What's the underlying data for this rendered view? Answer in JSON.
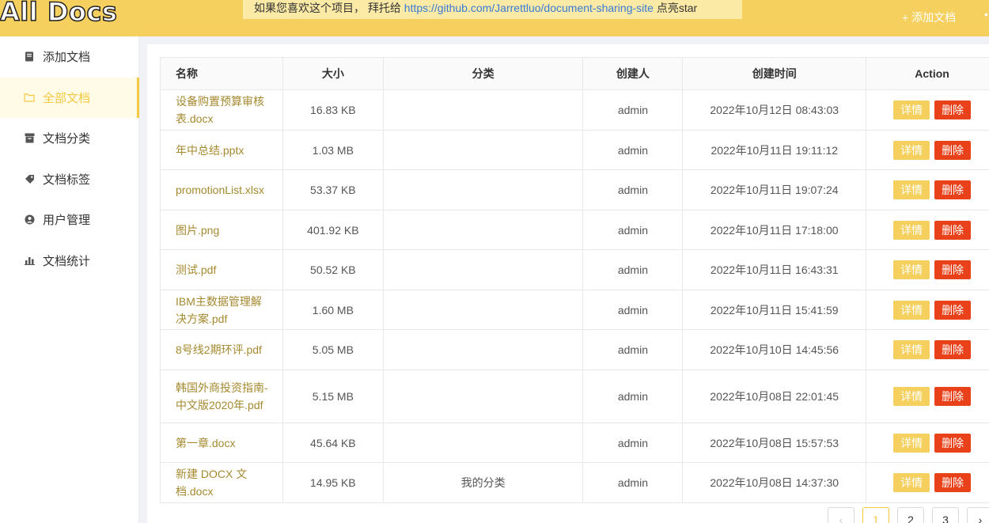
{
  "header": {
    "logo": "All Docs",
    "notice_prefix": "如果您喜欢这个项目， 拜托给 ",
    "notice_link": "https://github.com/Jarrettluo/document-sharing-site",
    "notice_suffix": " 点亮star",
    "add_doc": "+ 添加文档"
  },
  "sidebar": {
    "items": [
      {
        "label": "添加文档",
        "icon": "book-icon"
      },
      {
        "label": "全部文档",
        "icon": "folder-icon"
      },
      {
        "label": "文档分类",
        "icon": "archive-icon"
      },
      {
        "label": "文档标签",
        "icon": "tag-icon"
      },
      {
        "label": "用户管理",
        "icon": "user-icon"
      },
      {
        "label": "文档统计",
        "icon": "bar-chart-icon"
      }
    ]
  },
  "table": {
    "headers": [
      "名称",
      "大小",
      "分类",
      "创建人",
      "创建时间",
      "Action"
    ],
    "detail_label": "详情",
    "delete_label": "删除",
    "rows": [
      {
        "name": "设备购置预算审核表.docx",
        "size": "16.83 KB",
        "category": "",
        "creator": "admin",
        "time": "2022年10月12日 08:43:03"
      },
      {
        "name": "年中总结.pptx",
        "size": "1.03 MB",
        "category": "",
        "creator": "admin",
        "time": "2022年10月11日 19:11:12"
      },
      {
        "name": "promotionList.xlsx",
        "size": "53.37 KB",
        "category": "",
        "creator": "admin",
        "time": "2022年10月11日 19:07:24"
      },
      {
        "name": "图片.png",
        "size": "401.92 KB",
        "category": "",
        "creator": "admin",
        "time": "2022年10月11日 17:18:00"
      },
      {
        "name": "测试.pdf",
        "size": "50.52 KB",
        "category": "",
        "creator": "admin",
        "time": "2022年10月11日 16:43:31"
      },
      {
        "name": "IBM主数据管理解决方案.pdf",
        "size": "1.60 MB",
        "category": "",
        "creator": "admin",
        "time": "2022年10月11日 15:41:59"
      },
      {
        "name": "8号线2期环评.pdf",
        "size": "5.05 MB",
        "category": "",
        "creator": "admin",
        "time": "2022年10月10日 14:45:56"
      },
      {
        "name": "韩国外商投资指南-中文版2020年.pdf",
        "size": "5.15 MB",
        "category": "",
        "creator": "admin",
        "time": "2022年10月08日 22:01:45"
      },
      {
        "name": "第一章.docx",
        "size": "45.64 KB",
        "category": "",
        "creator": "admin",
        "time": "2022年10月08日 15:57:53"
      },
      {
        "name": "新建 DOCX 文档.docx",
        "size": "14.95 KB",
        "category": "我的分类",
        "creator": "admin",
        "time": "2022年10月08日 14:37:30"
      }
    ]
  },
  "pagination": {
    "prev": "‹",
    "pages": [
      "1",
      "2",
      "3"
    ],
    "next": "›",
    "current": "1"
  }
}
